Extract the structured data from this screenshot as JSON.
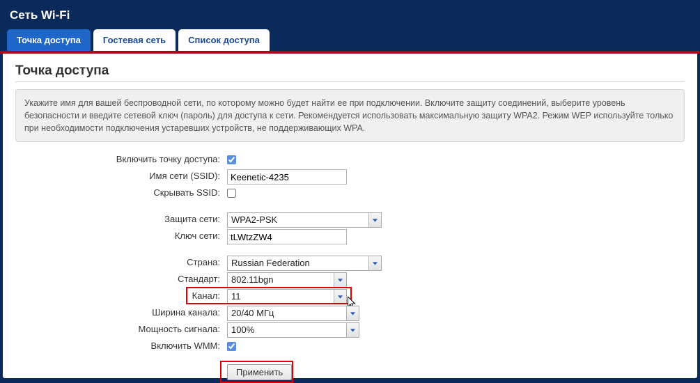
{
  "page_title": "Сеть Wi-Fi",
  "tabs": {
    "ap": "Точка доступа",
    "guest": "Гостевая сеть",
    "access": "Список доступа"
  },
  "section_title": "Точка доступа",
  "help_text": "Укажите имя для вашей беспроводной сети, по которому можно будет найти ее при подключении. Включите защиту соединений, выберите уровень безопасности и введите сетевой ключ (пароль) для доступа к сети. Рекомендуется использовать максимальную защиту WPA2. Режим WEP используйте только при необходимости подключения устаревших устройств, не поддерживающих WPA.",
  "form": {
    "labels": {
      "enable_ap": "Включить точку доступа:",
      "ssid": "Имя сети (SSID):",
      "hide_ssid": "Скрывать SSID:",
      "security": "Защита сети:",
      "key": "Ключ сети:",
      "country": "Страна:",
      "standard": "Стандарт:",
      "channel": "Канал:",
      "width": "Ширина канала:",
      "power": "Мощность сигнала:",
      "wmm": "Включить WMM:"
    },
    "values": {
      "enable_ap": true,
      "ssid": "Keenetic-4235",
      "hide_ssid": false,
      "security": "WPA2-PSK",
      "key": "tLWtzZW4",
      "country": "Russian Federation",
      "standard": "802.11bgn",
      "channel": "11",
      "width": "20/40 МГц",
      "power": "100%",
      "wmm": true
    },
    "submit": "Применить"
  }
}
